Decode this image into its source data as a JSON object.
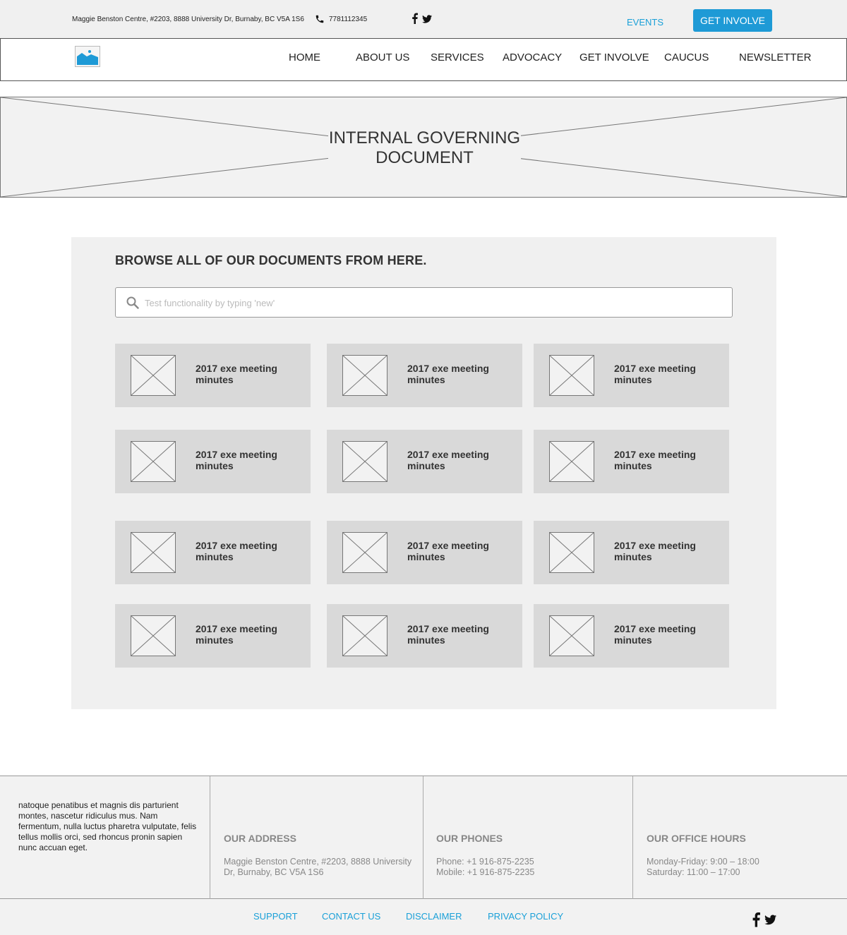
{
  "topbar": {
    "address": "Maggie Benston Centre, #2203, 8888 University Dr, Burnaby, BC V5A 1S6",
    "phone": "7781112345",
    "events_label": "EVENTS",
    "cta_label": "GET INVOLVE"
  },
  "nav": {
    "items": [
      {
        "label": "HOME"
      },
      {
        "label": "ABOUT US"
      },
      {
        "label": "SERVICES"
      },
      {
        "label": "ADVOCACY"
      },
      {
        "label": "GET INVOLVE"
      },
      {
        "label": "CAUCUS"
      },
      {
        "label": "NEWSLETTER"
      }
    ]
  },
  "hero": {
    "title": "INTERNAL GOVERNING DOCUMENT"
  },
  "browse": {
    "heading": "BROWSE ALL OF OUR DOCUMENTS FROM HERE.",
    "search_placeholder": "Test functionality by typing 'new'",
    "documents": [
      {
        "title": "2017 exe meeting minutes"
      },
      {
        "title": "2017 exe meeting minutes"
      },
      {
        "title": "2017 exe meeting minutes"
      },
      {
        "title": "2017 exe meeting minutes"
      },
      {
        "title": "2017 exe meeting minutes"
      },
      {
        "title": "2017 exe meeting minutes"
      },
      {
        "title": "2017 exe meeting minutes"
      },
      {
        "title": "2017 exe meeting minutes"
      },
      {
        "title": "2017 exe meeting minutes"
      },
      {
        "title": "2017 exe meeting minutes"
      },
      {
        "title": "2017 exe meeting minutes"
      },
      {
        "title": "2017 exe meeting minutes"
      }
    ]
  },
  "footer": {
    "blurb": "natoque penatibus et magnis dis parturient montes, nascetur ridiculus mus. Nam fermentum, nulla luctus pharetra vulputate, felis tellus mollis orci, sed rhoncus pronin sapien nunc accuan eget.",
    "address_heading": "OUR ADDRESS",
    "address_text": "Maggie Benston Centre, #2203, 8888 University Dr, Burnaby, BC V5A 1S6",
    "phones_heading": "OUR PHONES",
    "phone_line": "Phone: +1 916-875-2235",
    "mobile_line": "Mobile: +1 916-875-2235",
    "hours_heading": "OUR OFFICE HOURS",
    "hours_weekday": "Monday-Friday: 9:00 – 18:00",
    "hours_saturday": "Saturday: 11:00 – 17:00"
  },
  "bottom_links": {
    "support": "SUPPORT",
    "contact": "CONTACT US",
    "disclaimer": "DISCLAIMER",
    "privacy": "PRIVACY POLICY"
  },
  "colors": {
    "accent": "#1e9ad6",
    "link": "#1aa0d8",
    "card": "#d9d9d9",
    "panel": "#f0f0f0"
  },
  "icons": [
    "phone-icon",
    "facebook-icon",
    "twitter-icon",
    "image-logo-icon",
    "search-icon",
    "placeholder-image-icon"
  ]
}
